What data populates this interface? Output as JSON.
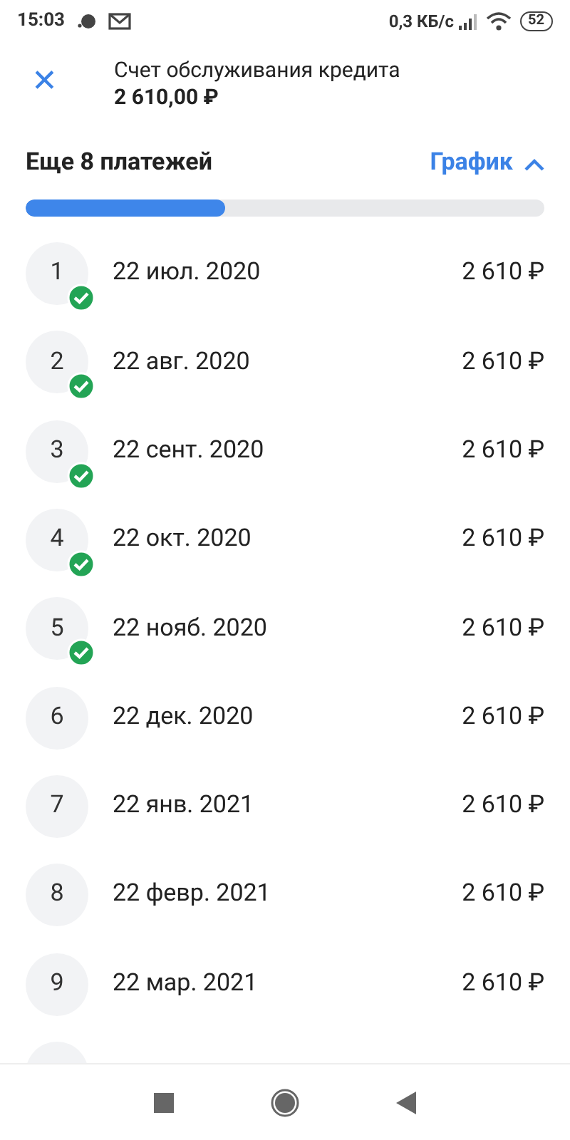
{
  "status_bar": {
    "time": "15:03",
    "speed": "0,3 КБ/с",
    "battery": "52"
  },
  "header": {
    "close": "✕",
    "title": "Счет обслуживания кредита",
    "amount": "2 610,00 ₽"
  },
  "summary": {
    "title": "Еще 8 платежей",
    "schedule_link": "График",
    "expanded": true,
    "level": 0.385
  },
  "payments": [
    {
      "number": "1",
      "date": "22 июл. 2020",
      "amount": "2 610 ₽",
      "paid": true
    },
    {
      "number": "2",
      "date": "22 авг. 2020",
      "amount": "2 610 ₽",
      "paid": true
    },
    {
      "number": "3",
      "date": "22 сент. 2020",
      "amount": "2 610 ₽",
      "paid": true
    },
    {
      "number": "4",
      "date": "22 окт. 2020",
      "amount": "2 610 ₽",
      "paid": true
    },
    {
      "number": "5",
      "date": "22 нояб. 2020",
      "amount": "2 610 ₽",
      "paid": true
    },
    {
      "number": "6",
      "date": "22 дек. 2020",
      "amount": "2 610 ₽",
      "paid": false
    },
    {
      "number": "7",
      "date": "22 янв. 2021",
      "amount": "2 610 ₽",
      "paid": false
    },
    {
      "number": "8",
      "date": "22 февр. 2021",
      "amount": "2 610 ₽",
      "paid": false
    },
    {
      "number": "9",
      "date": "22 мар. 2021",
      "amount": "2 610 ₽",
      "paid": false
    }
  ]
}
